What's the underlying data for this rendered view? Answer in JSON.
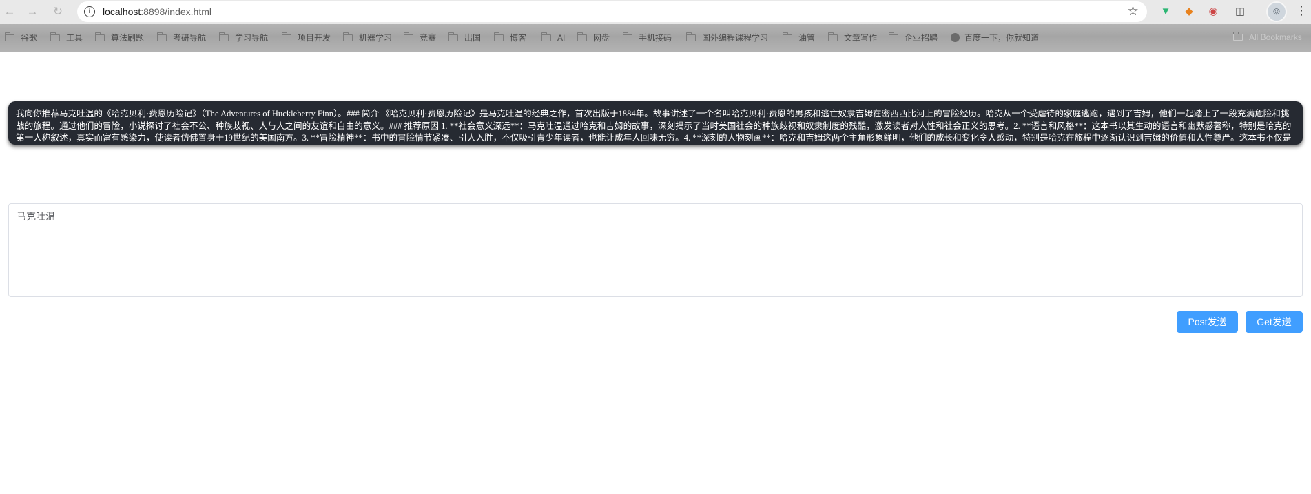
{
  "browser": {
    "url_host": "localhost",
    "url_path": ":8898/index.html",
    "icons": {
      "back": "back-arrow-icon",
      "forward": "forward-arrow-icon",
      "reload": "reload-icon",
      "site_info": "info-icon",
      "bookmark": "star-icon",
      "menu": "kebab-menu-icon"
    }
  },
  "bookmarks": {
    "items": [
      "谷歌",
      "工具",
      "算法刷题",
      "考研导航",
      "学习导航",
      "项目开发",
      "机器学习",
      "竞赛",
      "出国",
      "博客",
      "AI",
      "网盘",
      "手机接码",
      "国外编程课程学习",
      "油管",
      "文章写作",
      "企业招聘"
    ],
    "site_link": "百度一下，你就知道",
    "all_bookmarks": "All Bookmarks"
  },
  "main": {
    "answer_text": "我向你推荐马克吐温的《哈克贝利·费恩历险记》（The Adventures of Huckleberry Finn）。### 简介 《哈克贝利·费恩历险记》是马克吐温的经典之作，首次出版于1884年。故事讲述了一个名叫哈克贝利·费恩的男孩和逃亡奴隶吉姆在密西西比河上的冒险经历。哈克从一个受虐待的家庭逃跑，遇到了吉姆，他们一起踏上了一段充满危险和挑战的旅程。通过他们的冒险，小说探讨了社会不公、种族歧视、人与人之间的友谊和自由的意义。### 推荐原因 1. **社会意义深远**：马克吐温通过哈克和吉姆的故事，深刻揭示了当时美国社会的种族歧视和奴隶制度的残酷，激发读者对人性和社会正义的思考。2. **语言和风格**：这本书以其生动的语言和幽默感著称，特别是哈克的第一人称叙述，真实而富有感染力，使读者仿佛置身于19世纪的美国南方。3. **冒险精神**：书中的冒险情节紧凑、引人入胜，不仅吸引青少年读者，也能让成年人回味无穷。4. **深刻的人物刻画**：哈克和吉姆这两个主角形象鲜明，他们的成长和变化令人感动，特别是哈克在旅程中逐渐认识到吉姆的价值和人性尊严。这本书不仅是一部精彩的冒险小说，更是一部深刻的社会批判作品，值得一读。",
    "input_value": "马克吐温",
    "post_button": "Post发送",
    "get_button": "Get发送"
  },
  "colors": {
    "answer_bg": "#262a32",
    "button_primary": "#409eff"
  }
}
